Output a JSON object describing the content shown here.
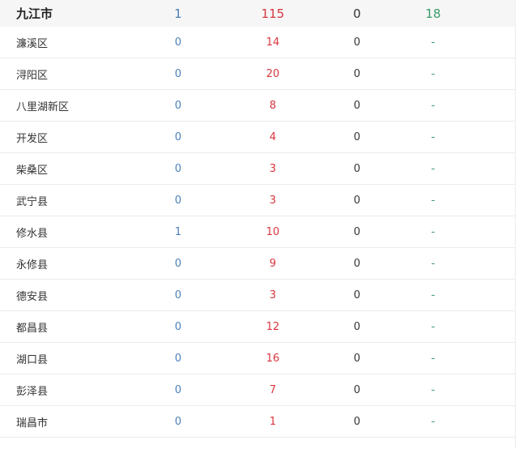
{
  "colors": {
    "blue": "#4a7fb5",
    "red": "#d9363e",
    "dark": "#333333",
    "green": "#3a9a6a"
  },
  "city": {
    "name": "九江市",
    "v1": "1",
    "v2": "115",
    "v3": "0",
    "v4": "18"
  },
  "districts": [
    {
      "name": "濂溪区",
      "v1": "0",
      "v2": "14",
      "v3": "0",
      "v4": "-"
    },
    {
      "name": "浔阳区",
      "v1": "0",
      "v2": "20",
      "v3": "0",
      "v4": "-"
    },
    {
      "name": "八里湖新区",
      "v1": "0",
      "v2": "8",
      "v3": "0",
      "v4": "-"
    },
    {
      "name": "开发区",
      "v1": "0",
      "v2": "4",
      "v3": "0",
      "v4": "-"
    },
    {
      "name": "柴桑区",
      "v1": "0",
      "v2": "3",
      "v3": "0",
      "v4": "-"
    },
    {
      "name": "武宁县",
      "v1": "0",
      "v2": "3",
      "v3": "0",
      "v4": "-"
    },
    {
      "name": "修水县",
      "v1": "1",
      "v2": "10",
      "v3": "0",
      "v4": "-"
    },
    {
      "name": "永修县",
      "v1": "0",
      "v2": "9",
      "v3": "0",
      "v4": "-"
    },
    {
      "name": "德安县",
      "v1": "0",
      "v2": "3",
      "v3": "0",
      "v4": "-"
    },
    {
      "name": "都昌县",
      "v1": "0",
      "v2": "12",
      "v3": "0",
      "v4": "-"
    },
    {
      "name": "湖口县",
      "v1": "0",
      "v2": "16",
      "v3": "0",
      "v4": "-"
    },
    {
      "name": "彭泽县",
      "v1": "0",
      "v2": "7",
      "v3": "0",
      "v4": "-"
    },
    {
      "name": "瑞昌市",
      "v1": "0",
      "v2": "1",
      "v3": "0",
      "v4": "-"
    }
  ]
}
